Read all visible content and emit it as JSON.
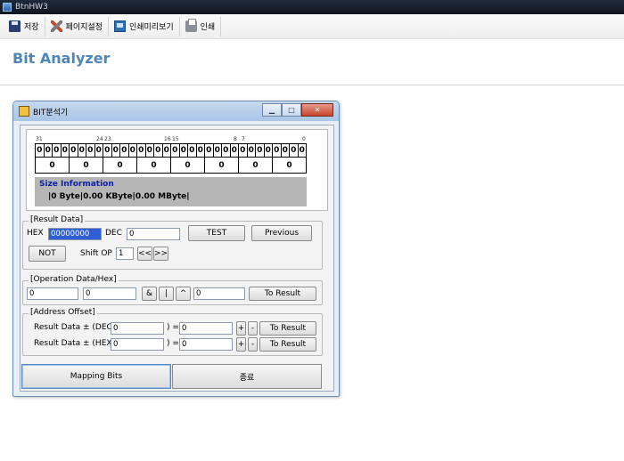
{
  "window": {
    "title": "BtnHW3"
  },
  "toolbar": {
    "items": [
      {
        "label": "저장",
        "icon": "save-icon"
      },
      {
        "label": "페이지설정",
        "icon": "page-setup-icon"
      },
      {
        "label": "인쇄미리보기",
        "icon": "print-preview-icon"
      },
      {
        "label": "인쇄",
        "icon": "print-icon"
      }
    ]
  },
  "page": {
    "title": "Bit Analyzer"
  },
  "dialog": {
    "title": "BIT분석기",
    "bit_indices": [
      "31",
      "24",
      "23",
      "16",
      "15",
      "8",
      "7",
      "0"
    ],
    "bits": [
      "0",
      "0",
      "0",
      "0",
      "0",
      "0",
      "0",
      "0",
      "0",
      "0",
      "0",
      "0",
      "0",
      "0",
      "0",
      "0",
      "0",
      "0",
      "0",
      "0",
      "0",
      "0",
      "0",
      "0",
      "0",
      "0",
      "0",
      "0",
      "0",
      "0",
      "0",
      "0"
    ],
    "bytes": [
      "0",
      "0",
      "0",
      "0",
      "0",
      "0",
      "0",
      "0"
    ],
    "size_info": {
      "title": "Size Information",
      "value": "|0 Byte|0.00 KByte|0.00 MByte|"
    },
    "result_data": {
      "legend": "[Result Data]",
      "hex_label": "HEX",
      "hex_value": "00000000",
      "dec_label": "DEC",
      "dec_value": "0",
      "test_label": "TEST",
      "previous_label": "Previous",
      "not_label": "NOT",
      "shift_label": "Shift OP",
      "shift_value": "1",
      "shift_left_label": "<<",
      "shift_right_label": ">>"
    },
    "operation": {
      "legend": "[Operation Data/Hex]",
      "operand_a": "0",
      "operand_b": "0",
      "and_label": "&",
      "or_label": "|",
      "xor_label": "^",
      "result_value": "0",
      "to_result_label": "To Result"
    },
    "address_offset": {
      "legend": "[Address Offset]",
      "dec_row_label": "Result Data ± (DEC",
      "dec_input": "0",
      "dec_eq": ") =",
      "dec_result": "0",
      "hex_row_label": "Result Data ± (HEX",
      "hex_input": "0",
      "hex_eq": ") =",
      "hex_result": "0",
      "plus_label": "+",
      "minus_label": "-",
      "to_result_label": "To Result"
    },
    "mapping_label": "Mapping Bits",
    "exit_label": "종료"
  }
}
